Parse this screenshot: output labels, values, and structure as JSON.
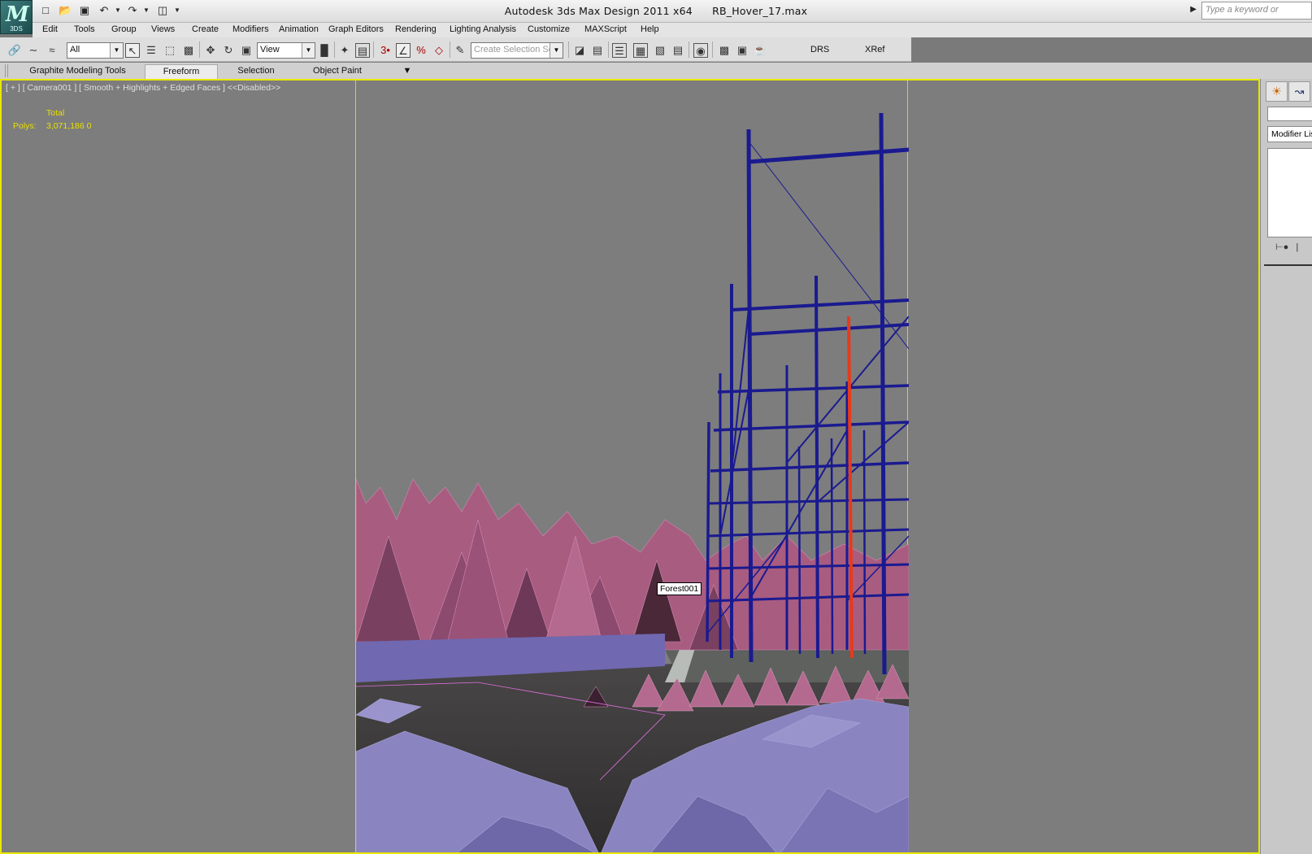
{
  "app": {
    "logo_text": "3DS",
    "title": "Autodesk 3ds Max Design 2011 x64",
    "filename": "RB_Hover_17.max",
    "search_placeholder": "Type a keyword or"
  },
  "menu": [
    "Edit",
    "Tools",
    "Group",
    "Views",
    "Create",
    "Modifiers",
    "Animation",
    "Graph Editors",
    "Rendering",
    "Lighting Analysis",
    "Customize",
    "MAXScript",
    "Help"
  ],
  "toolbar": {
    "selection_filter": "All",
    "ref_coord": "View",
    "named_selection_placeholder": "Create Selection Se",
    "drs_label": "DRS",
    "xref_label": "XRef"
  },
  "ribbon": {
    "tabs": [
      "Graphite Modeling Tools",
      "Freeform",
      "Selection",
      "Object Paint"
    ],
    "active": "Freeform"
  },
  "viewport": {
    "label": "[ + ] [ Camera001 ] [ Smooth + Highlights + Edged Faces ] <<Disabled>>",
    "stats_header": "Total",
    "polys_label": "Polys:",
    "polys_value": "3,071,186  0",
    "tooltip": "Forest001",
    "colors": {
      "background": "#7d7d7d",
      "frame": "#e8e800",
      "scaffold": "#1a1a90",
      "highlight": "#e83a1a",
      "trees": "#a85c80",
      "ground": "#8a84c0"
    }
  },
  "command_panel": {
    "modifier_list": "Modifier Lis",
    "tab_icons": [
      "sun-icon",
      "curve-icon"
    ]
  }
}
